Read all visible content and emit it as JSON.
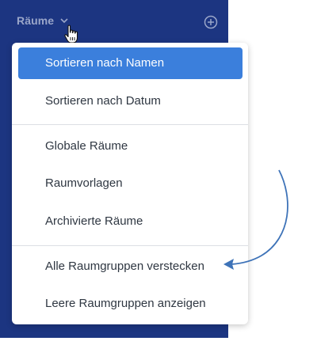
{
  "sidebar": {
    "section_label": "Räume",
    "dropdown_icon": "chevron-down-icon",
    "add_icon": "plus-circle-icon",
    "background_color": "#1c3581"
  },
  "menu": {
    "groups": [
      [
        {
          "label": "Sortieren nach Namen",
          "selected": true
        },
        {
          "label": "Sortieren nach Datum",
          "selected": false
        }
      ],
      [
        {
          "label": "Globale Räume",
          "selected": false
        },
        {
          "label": "Raumvorlagen",
          "selected": false
        },
        {
          "label": "Archivierte Räume",
          "selected": false
        }
      ],
      [
        {
          "label": "Alle Raumgruppen verstecken",
          "selected": false
        },
        {
          "label": "Leere Raumgruppen anzeigen",
          "selected": false
        }
      ]
    ],
    "selected_color": "#3b7fdc"
  },
  "annotation": {
    "arrow_color": "#3e73b8",
    "points_to": "Alle Raumgruppen verstecken"
  }
}
